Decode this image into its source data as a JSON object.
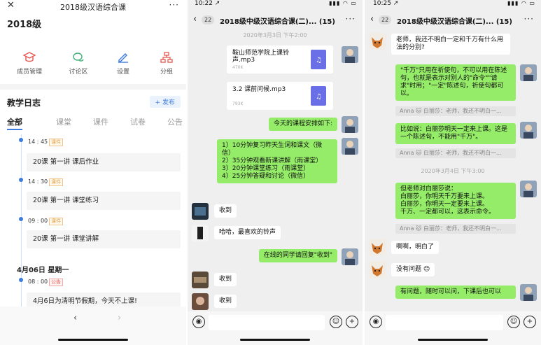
{
  "panel1": {
    "close_icon": "close-icon",
    "title": "2018级汉语综合课",
    "more": "···",
    "class_name": "2018级",
    "tools": [
      {
        "label": "成员管理",
        "icon": "graduation-cap-icon",
        "color": "#e8554e"
      },
      {
        "label": "讨论区",
        "icon": "chat-bubbles-icon",
        "color": "#3fb378"
      },
      {
        "label": "设置",
        "icon": "pen-edit-icon",
        "color": "#3c7be0"
      },
      {
        "label": "分组",
        "icon": "group-tree-icon",
        "color": "#e8554e"
      }
    ],
    "log_title": "教学日志",
    "publish": "+ 发布",
    "tabs": [
      "全部",
      "课堂",
      "课件",
      "试卷",
      "公告"
    ],
    "entries": [
      {
        "time": "14 : 45",
        "tag": "课件",
        "text": "20课 第一讲 课后作业"
      },
      {
        "time": "14 : 30",
        "tag": "课件",
        "text": "20课 第一讲 课堂练习"
      },
      {
        "time": "09 : 00",
        "tag": "课件",
        "text": "20课 第一讲 课堂讲解"
      }
    ],
    "date_heading": "4月06日  星期一",
    "notice": {
      "time": "08 : 00",
      "tag": "公告",
      "text": "4月6日为清明节假期，今天不上课!"
    },
    "nav_back": "‹",
    "nav_forward": "›"
  },
  "panel2": {
    "status_time": "10:22 ↗",
    "status_icons": "▮▮▮ ◠ ▭",
    "back_count": "22",
    "title": "2018级中级汉语综合课(二)... (15)",
    "more": "···",
    "timestamp": "2020年3月3日 下午2:00",
    "files": [
      {
        "name": "鞍山师范学院上课铃声.mp3",
        "size": "470K"
      },
      {
        "name": "3.2 课前问候.mp3",
        "size": "793K"
      }
    ],
    "msg_schedule_intro": "今天的课程安排如下:",
    "msg_schedule": "1）10分钟复习昨天生词和课文（微信）\n2）35分钟观看新课讲解（雨课堂）\n3）20分钟课堂练习（雨课堂）\n4）25分钟答疑和讨论（微信）",
    "msg_received": "收到",
    "msg_ringtone": "哈哈，最喜欢的铃声",
    "msg_reply_request": "在线的同学请回复\"收到\"",
    "msg_received_2": "收到",
    "msg_received_3": "收到"
  },
  "panel3": {
    "status_time": "10:25 ↗",
    "status_icons": "▮▮▮ ◠ ▭",
    "back_count": "22",
    "title": "2018级中级汉语综合课(二)... (15)",
    "more": "···",
    "msg_question": "老师，我还不明白一定和千万有什么用法的分别?",
    "msg_answer1": "\"千万\"只用在祈使句，不可以用在陈述句，也就是表示对别人的\"命令\"\"请求\"时用；\"一定\"陈述句，祈使句都可以。",
    "quote1": "Anna 🐱 白丽莎：老师，我还不明白一...",
    "msg_answer2": "比如说：白丽莎明天一定来上课。这是一个陈述句，不能用\"千万\"。",
    "quote2": "Anna 🐱 白丽莎：老师，我还不明白一...",
    "timestamp": "2020年3月4日 下午3:00",
    "msg_answer3": "但老师对白丽莎说：\n白丽莎，你明天千万要来上课。\n白丽莎，你明天一定要来上课。\n千万、一定都可以，这表示命令。",
    "quote3": "Anna 🐱 白丽莎：老师，我还不明白一...",
    "msg_understood": "啊啊，明白了",
    "msg_no_problem": "没有问题 😊",
    "msg_ask_anytime": "有问题，随时可以问，下课后也可以"
  }
}
